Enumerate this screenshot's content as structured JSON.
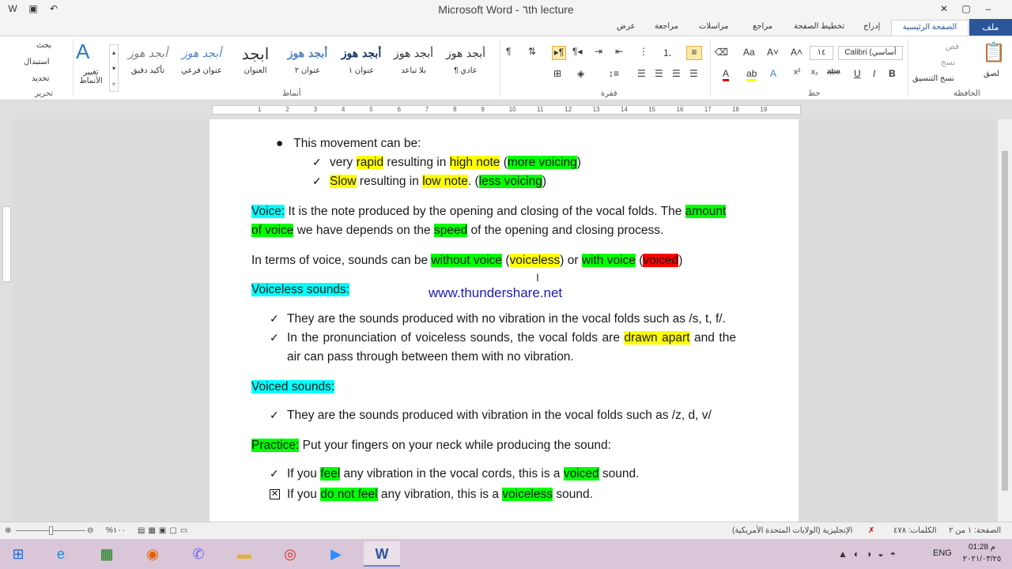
{
  "window": {
    "title": "Microsoft Word - ٦th lecture"
  },
  "tabs": {
    "file": "ملف",
    "home": "الصفحة الرئيسية",
    "insert": "إدراج",
    "layout": "تخطيط الصفحة",
    "references": "مراجع",
    "mailings": "مراسلات",
    "review": "مراجعة",
    "view": "عرض"
  },
  "ribbon": {
    "clipboard": {
      "label": "الحافظة",
      "paste": "لصق",
      "cut": "قص",
      "copy": "نسخ",
      "format_painter": "نسخ التنسيق"
    },
    "font": {
      "label": "خط",
      "name": "Calibri (أساسي",
      "size": "١٤"
    },
    "paragraph": {
      "label": "فقرة"
    },
    "styles": {
      "label": "أنماط",
      "items": [
        {
          "sample": "أبجد هوز",
          "name": "¶ عادي"
        },
        {
          "sample": "أبجد هوز",
          "name": "بلا تباعد"
        },
        {
          "sample": "أبجد هوز",
          "name": "عنوان ١"
        },
        {
          "sample": "أبجد هوز",
          "name": "عنوان ٢"
        },
        {
          "sample": "ابجد",
          "name": "العنوان"
        },
        {
          "sample": "أبجد هوز",
          "name": "عنوان فرعي"
        },
        {
          "sample": "أبجد هوز",
          "name": "تأكيد دقيق"
        }
      ],
      "change_styles": "تغيير الأنماط"
    },
    "editing": {
      "label": "تحرير",
      "find": "بحث",
      "replace": "استبدال",
      "select": "تحديد"
    }
  },
  "ruler": {
    "ticks": [
      "1",
      "2",
      "3",
      "4",
      "5",
      "6",
      "7",
      "8",
      "9",
      "10",
      "11",
      "12",
      "13",
      "14",
      "15",
      "16",
      "17",
      "18",
      "19"
    ]
  },
  "document": {
    "bullet_intro": "This movement can be:",
    "rapid_line": {
      "t1": "very ",
      "h1": "rapid",
      "t2": " resulting in ",
      "h2": "high note",
      "t3": " (",
      "h3": "more voicing",
      "t4": ")"
    },
    "slow_line": {
      "h1": "Slow",
      "t2": " resulting in ",
      "h2": "low note",
      "t3": ". (",
      "h3": "less voicing",
      "t4": ")"
    },
    "voice_para": {
      "h1": "Voice:",
      "t1": " It is the note produced by the opening and closing of the vocal folds. The ",
      "h2": "amount",
      "h3": "of voice",
      "t2": " we have depends on the ",
      "h4": "speed",
      "t3": " of the opening and closing process."
    },
    "terms_line": {
      "t1": "In terms of voice, sounds can be ",
      "h1": "without voice",
      "t2": " (",
      "h2": "voiceless",
      "t3": ") or ",
      "h3": "with voice",
      "t4": " (",
      "h4": "voiced",
      "t5": ")"
    },
    "voiceless_heading": "Voiceless sounds:",
    "watermark": "www.thundershare.net",
    "voiceless_1": "They are the sounds produced with no vibration in the vocal folds such as /s, t, f/.",
    "voiceless_2": {
      "t1": "In the pronunciation of voiceless sounds, the vocal folds are ",
      "h1": "drawn apart",
      "t2": " and the",
      "t3": "air can pass through between them with no vibration."
    },
    "voiced_heading": "Voiced sounds:",
    "voiced_1": "They are the sounds produced with vibration in the vocal folds such as /z, d, v/",
    "practice": {
      "h1": "Practice:",
      "t1": " Put your fingers on your neck while producing the sound:"
    },
    "practice_1": {
      "t1": "If you ",
      "h1": "feel",
      "t2": " any vibration in the vocal cords, this is a ",
      "h2": "voiced",
      "t3": " sound."
    },
    "practice_2": {
      "t1": "If you ",
      "h1": "do not feel",
      "t2": " any vibration, this is a ",
      "h2": "voiceless",
      "t3": " sound."
    }
  },
  "status": {
    "page": "الصفحة: ١ من ٢",
    "words": "الكلمات: ٤٧٨",
    "language": "الإنجليزية (الولايات المتحدة الأمريكية)",
    "zoom": "%١٠٠"
  },
  "taskbar": {
    "lang": "ENG",
    "time": "01:28 م",
    "date": "٢٠٢١/٠٣/٢٥"
  }
}
